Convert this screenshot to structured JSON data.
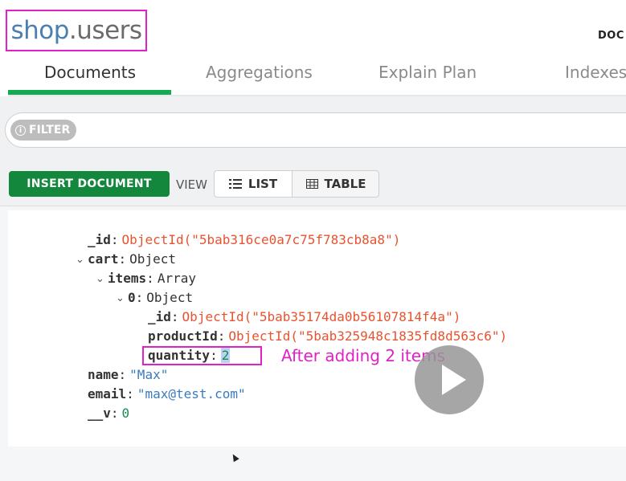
{
  "header": {
    "db_name": "shop",
    "dot": ".",
    "collection_name": "users",
    "documents_label": "DOC"
  },
  "tabs": [
    {
      "label": "Documents",
      "active": true
    },
    {
      "label": "Aggregations",
      "active": false
    },
    {
      "label": "Explain Plan",
      "active": false
    },
    {
      "label": "Indexes",
      "active": false
    }
  ],
  "filter": {
    "label": "FILTER",
    "value": ""
  },
  "toolbar": {
    "insert_label": "INSERT DOCUMENT",
    "view_label": "VIEW",
    "list_label": "LIST",
    "table_label": "TABLE"
  },
  "document": {
    "id_key": "_id",
    "id_value": "ObjectId(\"5bab316ce0a7c75f783cb8a8\")",
    "cart_key": "cart",
    "cart_type": "Object",
    "items_key": "items",
    "items_type": "Array",
    "item0_key": "0",
    "item0_type": "Object",
    "item_id_key": "_id",
    "item_id_value": "ObjectId(\"5bab35174da0b56107814f4a\")",
    "product_key": "productId",
    "product_value": "ObjectId(\"5bab325948c1835fd8d563c6\")",
    "quantity_key": "quantity",
    "quantity_value": "2",
    "name_key": "name",
    "name_value": "\"Max\"",
    "email_key": "email",
    "email_value": "\"max@test.com\"",
    "v_key": "__v",
    "v_value": "0"
  },
  "annotation": "After adding 2 items",
  "colors": {
    "accent_green": "#13aa52",
    "highlight_magenta": "#e020c8",
    "objectid_orange": "#e8532f"
  },
  "icons": [
    "info-icon",
    "list-icon",
    "table-icon",
    "play-icon",
    "cursor-icon",
    "caret-down-icon"
  ]
}
